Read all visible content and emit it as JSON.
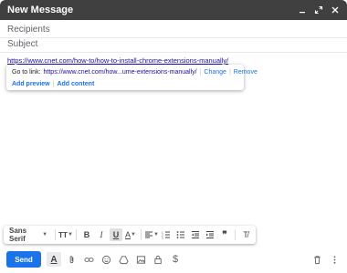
{
  "window": {
    "title": "New Message"
  },
  "compose": {
    "recipients_placeholder": "Recipients",
    "subject_placeholder": "Subject",
    "body_link": "https://www.cnet.com/how-to/how-to-install-chrome-extensions-manually/"
  },
  "link_popup": {
    "go_to_link_label": "Go to link:",
    "truncated_url": "https://www.cnet.com/how...ume-extensions-manually/",
    "change_label": "Change",
    "remove_label": "Remove",
    "add_preview_label": "Add preview",
    "add_content_label": "Add content"
  },
  "format_toolbar": {
    "font_name": "Sans Serif",
    "size_icon_text": "TT",
    "bold_text": "B",
    "italic_text": "I",
    "underline_text": "U",
    "text_color_text": "A",
    "quote_text": "❞",
    "clear_format_text": "T̸"
  },
  "bottom_bar": {
    "send_label": "Send",
    "format_icon_text": "A",
    "signature_text": "$"
  },
  "colors": {
    "titlebar": "#404040",
    "accent": "#1a73e8",
    "link": "#1a0dab"
  }
}
